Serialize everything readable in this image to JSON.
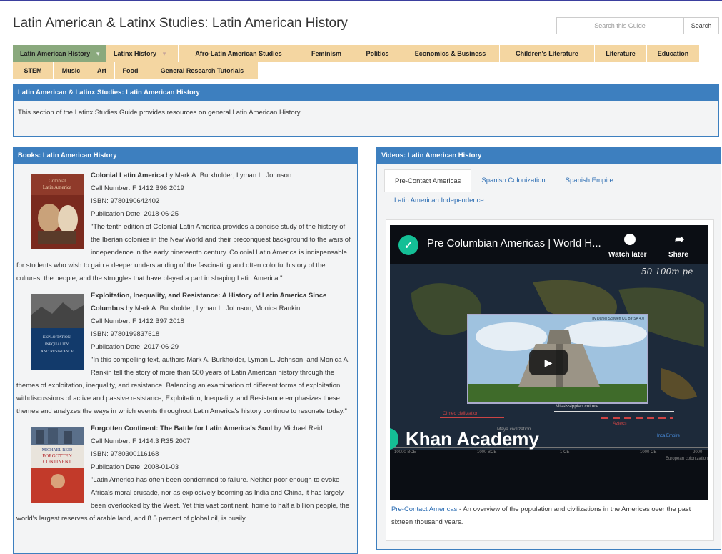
{
  "header": {
    "title": "Latin American & Latinx Studies: Latin American History",
    "search_placeholder": "Search this Guide",
    "search_button": "Search"
  },
  "tabs_row1": [
    {
      "label": "Latin American History",
      "active": true,
      "dropdown": true
    },
    {
      "label": "Latinx History",
      "active": false,
      "dropdown": true
    },
    {
      "label": "Afro-Latin American Studies",
      "active": false,
      "dropdown": false
    },
    {
      "label": "Feminism",
      "active": false,
      "dropdown": false
    },
    {
      "label": "Politics",
      "active": false,
      "dropdown": false
    },
    {
      "label": "Economics & Business",
      "active": false,
      "dropdown": false
    },
    {
      "label": "Children's Literature",
      "active": false,
      "dropdown": false
    },
    {
      "label": "Literature",
      "active": false,
      "dropdown": false
    },
    {
      "label": "Education",
      "active": false,
      "dropdown": false
    }
  ],
  "tabs_row2": [
    {
      "label": "STEM"
    },
    {
      "label": "Music"
    },
    {
      "label": "Art"
    },
    {
      "label": "Food"
    },
    {
      "label": "General Research Tutorials"
    }
  ],
  "intro": {
    "heading": "Latin American & Latinx Studies: Latin American History",
    "text": "This section of the Latinx Studies Guide provides resources on general Latin American History."
  },
  "books": {
    "heading": "Books: Latin American History",
    "items": [
      {
        "title": "Colonial Latin America",
        "authors": " by Mark A. Burkholder; Lyman L. Johnson",
        "call": "Call Number: F 1412 B96 2019",
        "isbn": "ISBN: 9780190642402",
        "date": "Publication Date: 2018-06-25",
        "desc": "\"The tenth edition of Colonial Latin America provides a concise study of the history of the Iberian colonies in the New World and their preconquest background to the wars of independence in the early nineteenth century. Colonial Latin America is indispensable for students who wish to gain a deeper understanding of the fascinating and often colorful history of the cultures, the people, and the struggles that have played a part in shaping Latin America.\"",
        "cover_title": "Colonial Latin America"
      },
      {
        "title": "Exploitation, Inequality, and Resistance: A History of Latin America Since Columbus",
        "authors": " by Mark A. Burkholder; Lyman L. Johnson; Monica Rankin",
        "call": "Call Number: F 1412 B97 2018",
        "isbn": "ISBN: 9780199837618",
        "date": "Publication Date: 2017-06-29",
        "desc": "\"In this compelling text, authors Mark A. Burkholder, Lyman L. Johnson, and Monica A. Rankin tell the story of more than 500 years of Latin American history through the themes of exploitation, inequality, and resistance. Balancing an examination of different forms of exploitation withdiscussions of active and passive resistance, Exploitation, Inequality, and Resistance emphasizes these themes and analyzes the ways in which events throughout Latin America's history continue to resonate today.\"",
        "cover_title": "EXPLOITATION, INEQUALITY, AND RESISTANCE"
      },
      {
        "title": "Forgotten Continent: The Battle for Latin America's Soul",
        "authors": " by Michael Reid",
        "call": "Call Number: F 1414.3 R35 2007",
        "isbn": "ISBN: 9780300116168",
        "date": "Publication Date: 2008-01-03",
        "desc": "\"Latin America has often been condemned to failure. Neither poor enough to evoke Africa's moral crusade, nor as explosively booming as India and China, it has largely been overlooked by the West. Yet this vast continent, home to half a billion people, the world's largest reserves of arable land, and 8.5 percent of global oil, is busily",
        "cover_title": "MICHAEL REID FORGOTTEN CONTINENT"
      }
    ]
  },
  "videos": {
    "heading": "Videos: Latin American History",
    "tabs": [
      {
        "label": "Pre-Contact Americas",
        "active": true
      },
      {
        "label": "Spanish Colonization",
        "active": false
      },
      {
        "label": "Spanish Empire",
        "active": false
      },
      {
        "label": "Latin American Independence",
        "active": false
      }
    ],
    "player": {
      "title": "Pre Columbian Americas | World H...",
      "watch_later": "Watch later",
      "share": "Share",
      "brand": "Khan Academy",
      "handwritten": "50-100m pe",
      "photo_credit": "by Daniel Schwen CC BY-SA 4.0",
      "timeline_labels": [
        "Olmec civilization",
        "Mississippian culture",
        "Aztecs",
        "Maya civilization",
        "Inca Empire",
        "European colonization"
      ],
      "axis_labels": [
        "10000 BCE",
        "1000 BCE",
        "1 CE",
        "1000 CE",
        "2000"
      ]
    },
    "caption_link": "Pre-Contact Americas",
    "caption_text": " - An overview of the population and civilizations in the Americas over the past sixteen thousand years."
  }
}
